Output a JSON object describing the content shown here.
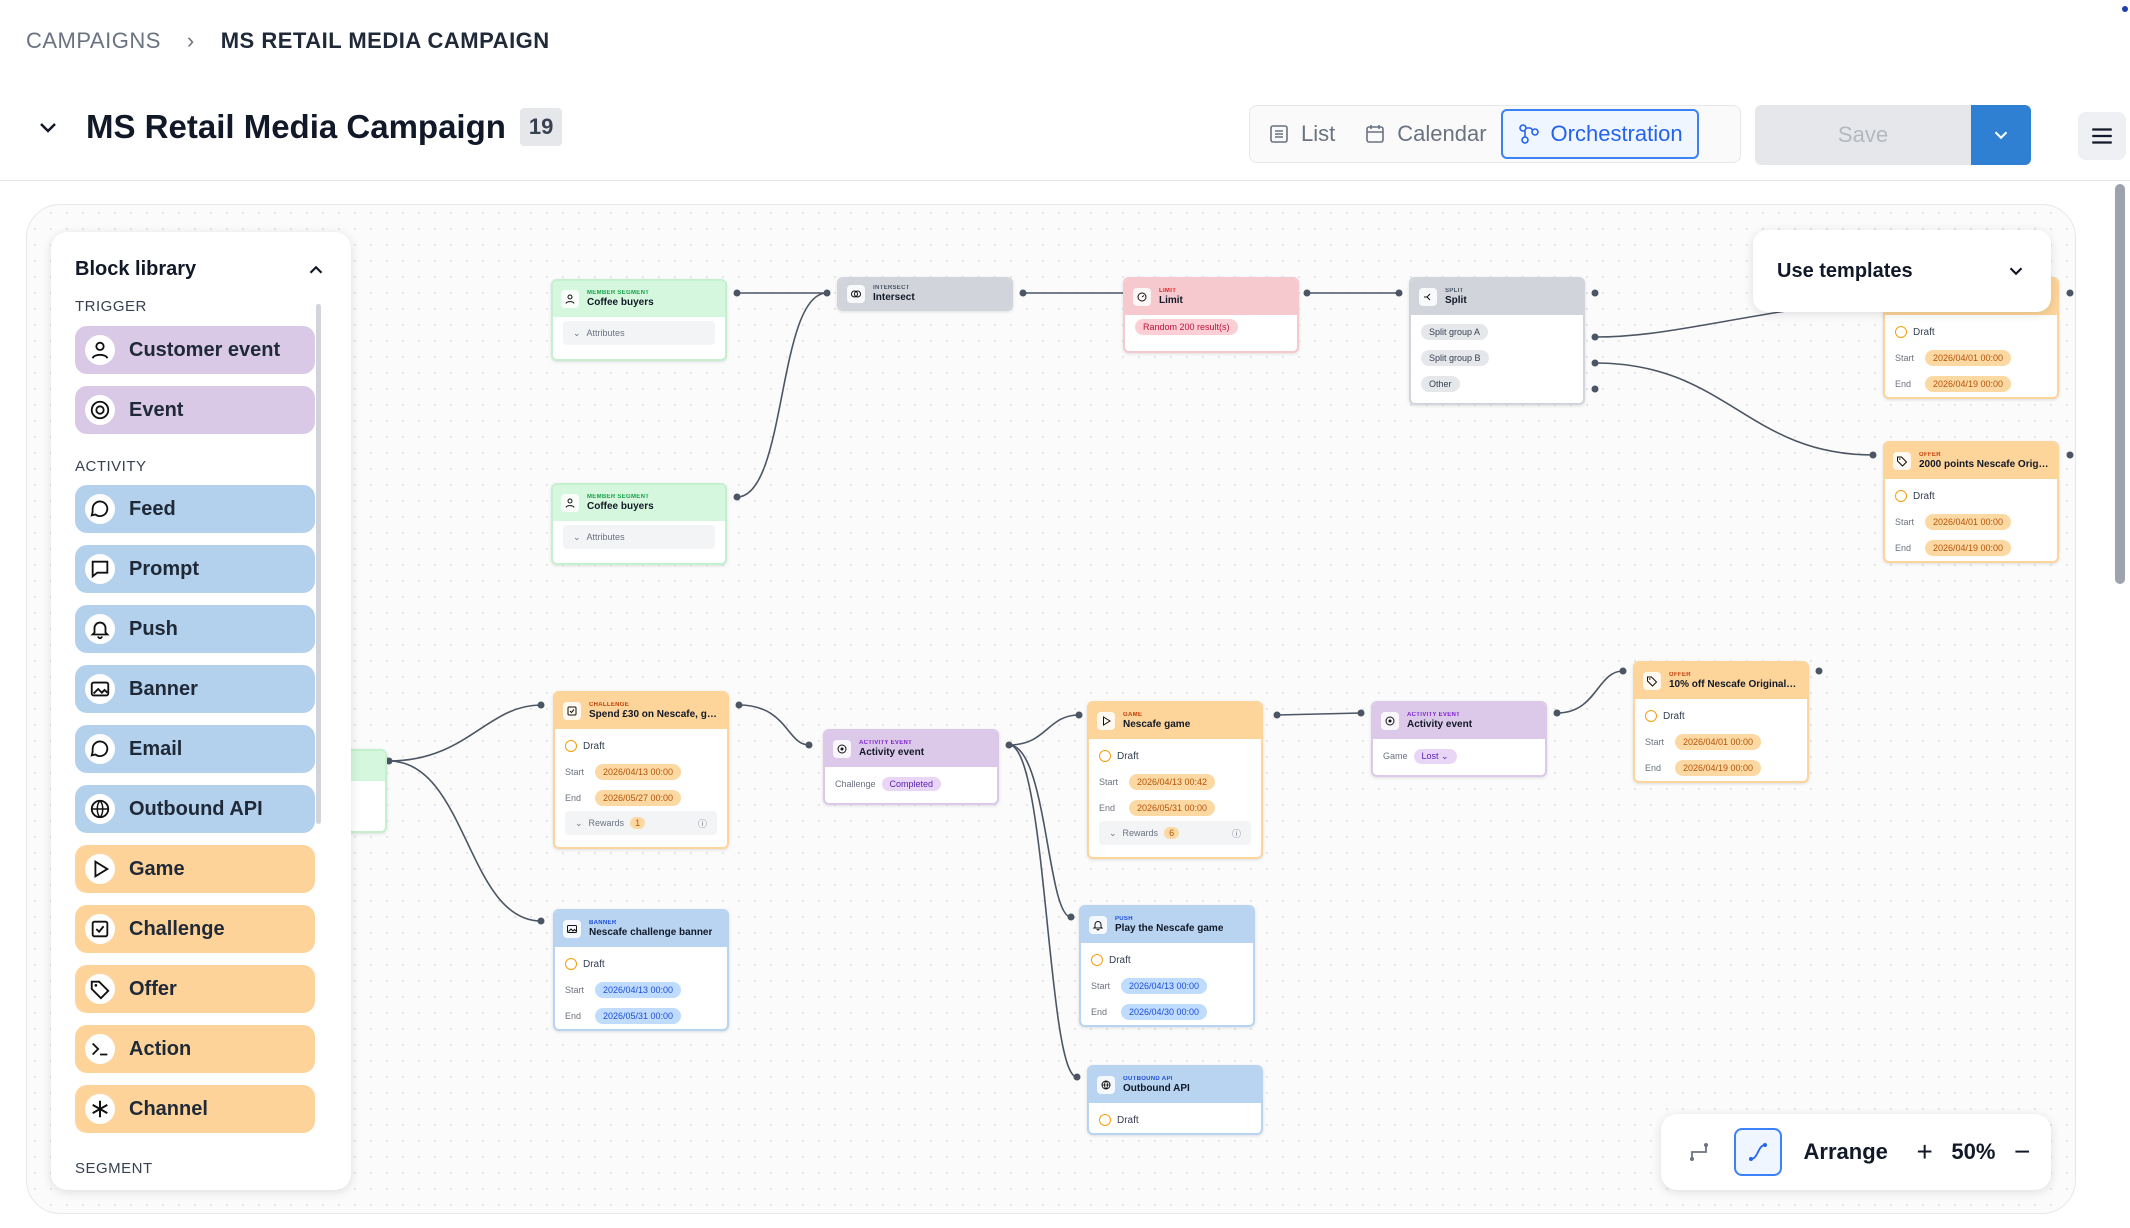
{
  "breadcrumb": {
    "root": "CAMPAIGNS",
    "current": "MS RETAIL MEDIA CAMPAIGN"
  },
  "campaign": {
    "title": "MS Retail Media Campaign",
    "count": "19"
  },
  "views": {
    "list": "List",
    "calendar": "Calendar",
    "orchestration": "Orchestration",
    "active": "Orchestration"
  },
  "actions": {
    "save": "Save"
  },
  "library": {
    "title": "Block library",
    "sections": {
      "trigger": "TRIGGER",
      "activity": "ACTIVITY",
      "segment": "SEGMENT"
    },
    "trigger_items": [
      "Customer event",
      "Event"
    ],
    "activity_items": [
      "Feed",
      "Prompt",
      "Push",
      "Banner",
      "Email",
      "Outbound API",
      "Game",
      "Challenge",
      "Offer",
      "Action",
      "Channel"
    ]
  },
  "templates": {
    "label": "Use templates"
  },
  "toolbar": {
    "arrange": "Arrange",
    "zoom": "50%"
  },
  "nodes": {
    "seg1": {
      "type": "MEMBER SEGMENT",
      "name": "Coffee buyers",
      "sub": "Attributes"
    },
    "seg2": {
      "type": "MEMBER SEGMENT",
      "name": "Coffee buyers",
      "sub": "Attributes"
    },
    "intersect": {
      "type": "INTERSECT",
      "name": "Intersect"
    },
    "limit": {
      "type": "LIMIT",
      "name": "Limit",
      "pill": "Random 200 result(s)"
    },
    "split": {
      "type": "SPLIT",
      "name": "Split",
      "groups": [
        "Split group A",
        "Split group B",
        "Other"
      ]
    },
    "offer_top": {
      "status": "Draft",
      "start_label": "Start",
      "start": "2026/04/01 00:00",
      "end_label": "End",
      "end": "2026/04/19 00:00"
    },
    "offer_2000": {
      "type": "OFFER",
      "name": "2000 points Nescafe Origi...",
      "status": "Draft",
      "start_label": "Start",
      "start": "2026/04/01 00:00",
      "end_label": "End",
      "end": "2026/04/19 00:00"
    },
    "challenge": {
      "type": "CHALLENGE",
      "name": "Spend £30 on Nescafe, ge...",
      "status": "Draft",
      "start_label": "Start",
      "start": "2026/04/13 00:00",
      "end_label": "End",
      "end": "2026/05/27 00:00",
      "rewards": "Rewards",
      "rewards_count": "1"
    },
    "activity1": {
      "type": "ACTIVITY EVENT",
      "name": "Activity event",
      "field": "Challenge",
      "value": "Completed"
    },
    "game": {
      "type": "GAME",
      "name": "Nescafe game",
      "status": "Draft",
      "start_label": "Start",
      "start": "2026/04/13 00:42",
      "end_label": "End",
      "end": "2026/05/31 00:00",
      "rewards": "Rewards",
      "rewards_count": "6"
    },
    "activity2": {
      "type": "ACTIVITY EVENT",
      "name": "Activity event",
      "field": "Game",
      "value": "Lost"
    },
    "offer_10": {
      "type": "OFFER",
      "name": "10% off Nescafe Original I...",
      "status": "Draft",
      "start_label": "Start",
      "start": "2026/04/01 00:00",
      "end_label": "End",
      "end": "2026/04/19 00:00"
    },
    "banner": {
      "type": "BANNER",
      "name": "Nescafe challenge banner",
      "status": "Draft",
      "start_label": "Start",
      "start": "2026/04/13 00:00",
      "end_label": "End",
      "end": "2026/05/31 00:00"
    },
    "push": {
      "type": "PUSH",
      "name": "Play the Nescafe game",
      "status": "Draft",
      "start_label": "Start",
      "start": "2026/04/13 00:00",
      "end_label": "End",
      "end": "2026/04/30 00:00"
    },
    "outbound": {
      "type": "OUTBOUND API",
      "name": "Outbound API",
      "status": "Draft"
    }
  },
  "colors": {
    "accent": "#2f7fd3",
    "trigger": "#d9c9e6",
    "activity_blue": "#b3d0ed",
    "activity_orange": "#fdd39a"
  }
}
